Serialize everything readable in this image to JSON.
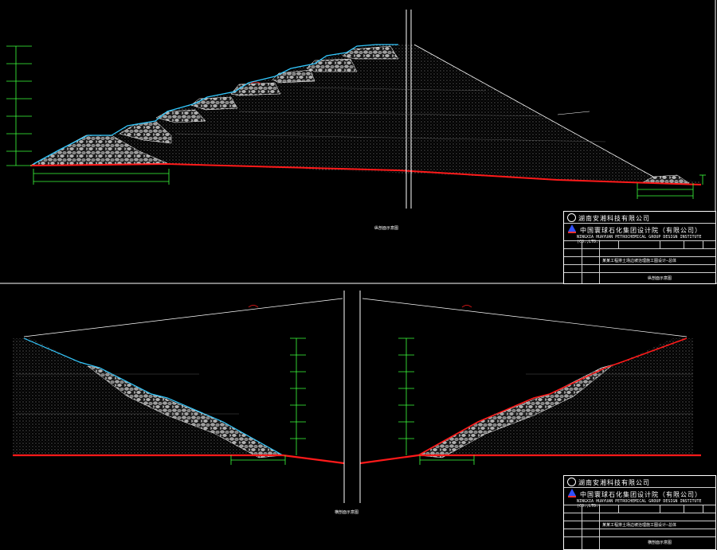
{
  "colors": {
    "background": "#000000",
    "ground_line": "#ff1a1a",
    "slope_line": "#33c9ff",
    "dim_line": "#3cff3c",
    "fill_dots": "#e8e8e8",
    "rock": "#c8c8c8",
    "frame": "#ffffff"
  },
  "upper_drawing": {
    "caption": "纵剖面示意图"
  },
  "lower_drawing": {
    "caption": "横剖面示意图"
  },
  "title_block_top": {
    "company": "湖南安湘科技有限公司",
    "institute": "中国寰球石化集团设计院（有限公司）",
    "institute_en": "NINGXIA HUAYUAN PETROCHEMICAL GROUP DESIGN INSTITUTE (CO.,LTD.)",
    "drawing_title": "某某工程排土场边坡治理施工图设计—总体",
    "sheet_title": "纵剖面示意图"
  },
  "title_block_bottom": {
    "company": "湖南安湘科技有限公司",
    "institute": "中国寰球石化集团设计院（有限公司）",
    "institute_en": "NINGXIA HUAYUAN PETROCHEMICAL GROUP DESIGN INSTITUTE (CO.,LTD.)",
    "drawing_title": "某某工程排土场边坡治理施工图设计—总体",
    "sheet_title": "横剖面示意图"
  }
}
